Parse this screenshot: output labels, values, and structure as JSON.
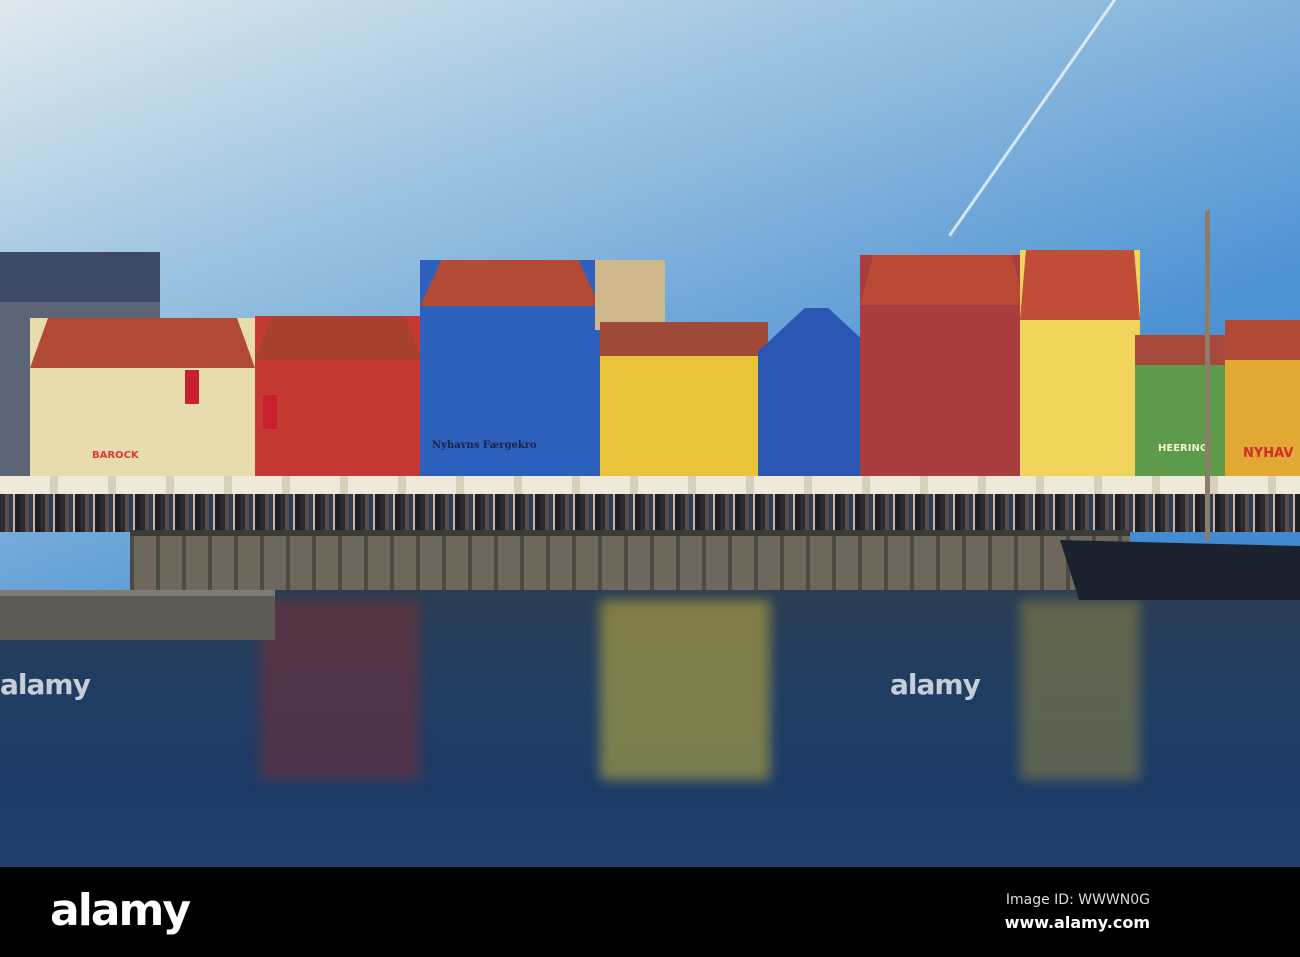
{
  "photo": {
    "signs": {
      "barock": "BAROCK",
      "faergekro": "Nyhavns Færgekro",
      "heering": "HEERING",
      "nyhavn": "NYHAV"
    },
    "watermark": "alamy"
  },
  "footer": {
    "logo": "alamy",
    "image_id": "Image ID: WWWN0G",
    "url": "www.alamy.com"
  }
}
